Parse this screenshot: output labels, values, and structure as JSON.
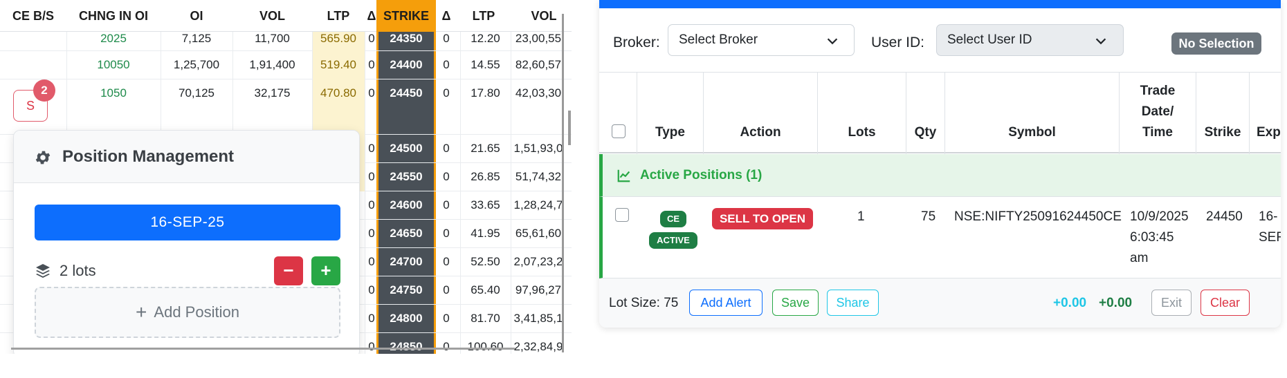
{
  "chain": {
    "headers": {
      "ce_bs": "CE B/S",
      "chng_in_oi": "CHNG IN OI",
      "oi": "OI",
      "vol": "VOL",
      "ltp": "LTP",
      "delta_ce": "Δ",
      "strike": "STRIKE",
      "delta_pe": "Δ",
      "ltp_pe": "LTP",
      "vol_pe": "VOL"
    },
    "rows": [
      {
        "chng_in_oi": "2025",
        "oi": "7,125",
        "vol": "11,700",
        "ltp": "565.90",
        "delta": "0",
        "strike": "24350",
        "delta_pe": "0",
        "ltp_pe": "12.20",
        "vol_pe": "23,00,55"
      },
      {
        "chng_in_oi": "10050",
        "oi": "1,25,700",
        "vol": "1,91,400",
        "ltp": "519.40",
        "delta": "0",
        "strike": "24400",
        "delta_pe": "0",
        "ltp_pe": "14.55",
        "vol_pe": "82,60,57"
      },
      {
        "chng_in_oi": "1050",
        "oi": "70,125",
        "vol": "32,175",
        "ltp": "470.80",
        "delta": "0",
        "strike": "24450",
        "delta_pe": "0",
        "ltp_pe": "17.80",
        "vol_pe": "42,03,30"
      },
      {
        "chng_in_oi": "",
        "oi": "",
        "vol": "",
        "ltp": "",
        "delta": "0",
        "strike": "24500",
        "delta_pe": "0",
        "ltp_pe": "21.65",
        "vol_pe": "1,51,93,0"
      },
      {
        "chng_in_oi": "",
        "oi": "",
        "vol": "",
        "ltp": "",
        "delta": "0",
        "strike": "24550",
        "delta_pe": "0",
        "ltp_pe": "26.85",
        "vol_pe": "51,74,32"
      },
      {
        "chng_in_oi": "",
        "oi": "",
        "vol": "",
        "ltp": "",
        "delta": "0",
        "strike": "24600",
        "delta_pe": "0",
        "ltp_pe": "33.65",
        "vol_pe": "1,28,24,7"
      },
      {
        "chng_in_oi": "",
        "oi": "",
        "vol": "",
        "ltp": "",
        "delta": "0",
        "strike": "24650",
        "delta_pe": "0",
        "ltp_pe": "41.95",
        "vol_pe": "65,61,60"
      },
      {
        "chng_in_oi": "",
        "oi": "",
        "vol": "",
        "ltp": "",
        "delta": "0",
        "strike": "24700",
        "delta_pe": "0",
        "ltp_pe": "52.50",
        "vol_pe": "2,07,23,2"
      },
      {
        "chng_in_oi": "",
        "oi": "",
        "vol": "",
        "ltp": "",
        "delta": "0",
        "strike": "24750",
        "delta_pe": "0",
        "ltp_pe": "65.40",
        "vol_pe": "97,96,27"
      },
      {
        "chng_in_oi": "",
        "oi": "",
        "vol": "",
        "ltp": "",
        "delta": "0",
        "strike": "24800",
        "delta_pe": "0",
        "ltp_pe": "81.70",
        "vol_pe": "3,41,85,1"
      },
      {
        "chng_in_oi": "",
        "oi": "",
        "vol": "",
        "ltp": "",
        "delta": "0",
        "strike": "24850",
        "delta_pe": "0",
        "ltp_pe": "100.60",
        "vol_pe": "2,32,84,9"
      }
    ],
    "sell_button_label": "S",
    "sell_badge_count": "2"
  },
  "position_management": {
    "title": "Position Management",
    "expiry_label": "16-SEP-25",
    "lots_label": "2 lots",
    "minus_label": "−",
    "plus_label": "+",
    "add_position_label": "Add Position",
    "add_position_plus": "+"
  },
  "orders": {
    "broker_label": "Broker:",
    "broker_value": "Select Broker",
    "user_label": "User ID:",
    "user_value": "Select User ID",
    "no_selection": "No Selection",
    "columns": [
      "Type",
      "Action",
      "Lots",
      "Qty",
      "Symbol",
      "Trade Date/ Time",
      "Strike",
      "Exp"
    ],
    "group_label": "Active Positions (1)",
    "position": {
      "type_badge": "CE",
      "status_badge": "ACTIVE",
      "action_badge": "SELL TO OPEN",
      "lots": "1",
      "qty": "75",
      "symbol": "NSE:NIFTY25091624450CE",
      "trade_date": "10/9/2025",
      "trade_time": "6:03:45",
      "trade_ampm": "am",
      "strike": "24450",
      "expiry_1": "16-",
      "expiry_2": "SEF"
    },
    "footer": {
      "lot_size": "Lot Size: 75",
      "add_alert": "Add Alert",
      "save": "Save",
      "share": "Share",
      "pnl_1": "+0.00",
      "pnl_2": "+0.00",
      "exit": "Exit",
      "clear": "Clear"
    }
  },
  "colors": {
    "primary": "#0d6efd",
    "strike_header": "#f59e0b",
    "strike_column": "#495057",
    "success": "#28a745",
    "danger": "#dc3545",
    "info": "#1ec6e6"
  }
}
